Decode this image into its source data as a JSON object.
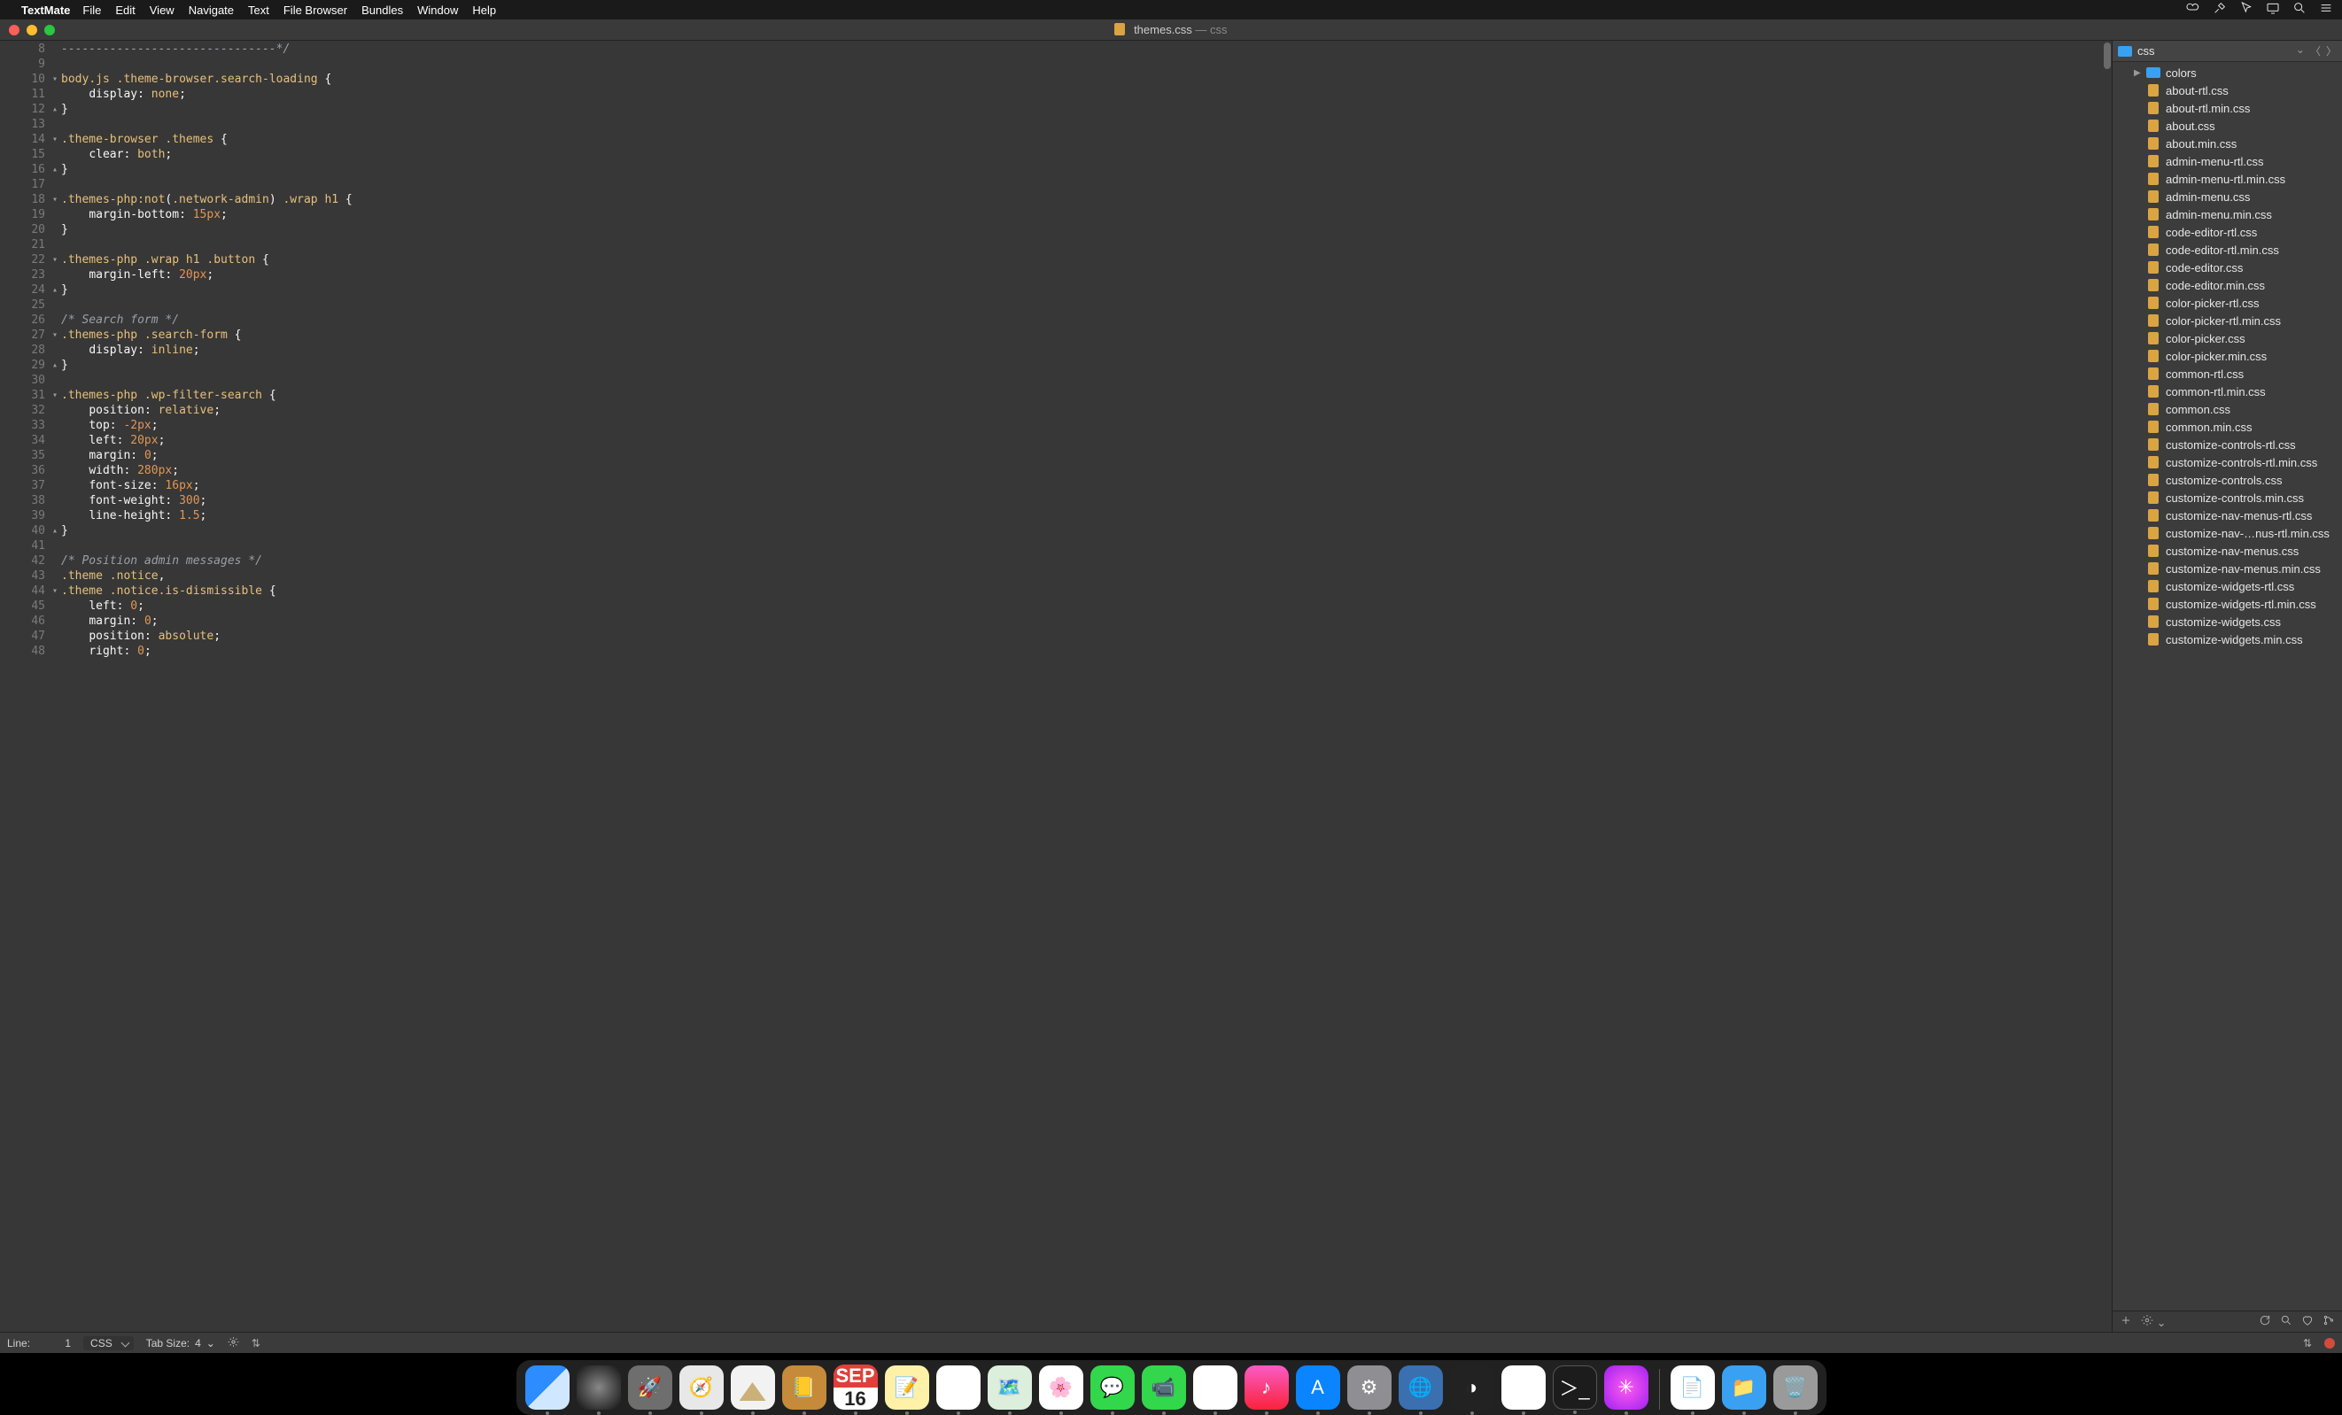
{
  "menubar": {
    "app": "TextMate",
    "items": [
      "File",
      "Edit",
      "View",
      "Navigate",
      "Text",
      "File Browser",
      "Bundles",
      "Window",
      "Help"
    ]
  },
  "window": {
    "filename": "themes.css",
    "title_suffix": " — css"
  },
  "gutter": {
    "start": 8,
    "end": 48,
    "fold_down": [
      10,
      14,
      18,
      22,
      27,
      31,
      44
    ],
    "fold_up": [
      12,
      16,
      24,
      29,
      40
    ]
  },
  "code": [
    {
      "n": 8,
      "html": "<span class='cmt'>-------------------------------*/</span>"
    },
    {
      "n": 9,
      "html": ""
    },
    {
      "n": 10,
      "html": "<span class='tag'>body</span><span class='sel'>.js</span> <span class='sel'>.theme-browser</span><span class='sel'>.search-loading</span> <span class='pun'>{</span>"
    },
    {
      "n": 11,
      "html": "    <span class='prop'>display</span><span class='pun'>:</span> <span class='ps'>none</span><span class='pun'>;</span>"
    },
    {
      "n": 12,
      "html": "<span class='pun'>}</span>"
    },
    {
      "n": 13,
      "html": ""
    },
    {
      "n": 14,
      "html": "<span class='sel'>.theme-browser</span> <span class='sel'>.themes</span> <span class='pun'>{</span>"
    },
    {
      "n": 15,
      "html": "    <span class='prop'>clear</span><span class='pun'>:</span> <span class='ps'>both</span><span class='pun'>;</span>"
    },
    {
      "n": 16,
      "html": "<span class='pun'>}</span>"
    },
    {
      "n": 17,
      "html": ""
    },
    {
      "n": 18,
      "html": "<span class='sel'>.themes-php</span><span class='ps'>:not</span><span class='pun'>(</span><span class='sel'>.network-admin</span><span class='pun'>)</span> <span class='sel'>.wrap</span> <span class='tag'>h1</span> <span class='pun'>{</span>"
    },
    {
      "n": 19,
      "html": "    <span class='prop'>margin-bottom</span><span class='pun'>:</span> <span class='num'>15px</span><span class='pun'>;</span>"
    },
    {
      "n": 20,
      "html": "<span class='pun'>}</span>"
    },
    {
      "n": 21,
      "html": ""
    },
    {
      "n": 22,
      "html": "<span class='sel'>.themes-php</span> <span class='sel'>.wrap</span> <span class='tag'>h1</span> <span class='sel'>.button</span> <span class='pun'>{</span>"
    },
    {
      "n": 23,
      "html": "    <span class='prop'>margin-left</span><span class='pun'>:</span> <span class='num'>20px</span><span class='pun'>;</span>"
    },
    {
      "n": 24,
      "html": "<span class='pun'>}</span>"
    },
    {
      "n": 25,
      "html": ""
    },
    {
      "n": 26,
      "html": "<span class='cmt'>/* Search form */</span>"
    },
    {
      "n": 27,
      "html": "<span class='sel'>.themes-php</span> <span class='sel'>.search-form</span> <span class='pun'>{</span>"
    },
    {
      "n": 28,
      "html": "    <span class='prop'>display</span><span class='pun'>:</span> <span class='ps'>inline</span><span class='pun'>;</span>"
    },
    {
      "n": 29,
      "html": "<span class='pun'>}</span>"
    },
    {
      "n": 30,
      "html": ""
    },
    {
      "n": 31,
      "html": "<span class='sel'>.themes-php</span> <span class='sel'>.wp-filter-search</span> <span class='pun'>{</span>"
    },
    {
      "n": 32,
      "html": "    <span class='prop'>position</span><span class='pun'>:</span> <span class='ps'>relative</span><span class='pun'>;</span>"
    },
    {
      "n": 33,
      "html": "    <span class='prop'>top</span><span class='pun'>:</span> <span class='num'>-2px</span><span class='pun'>;</span>"
    },
    {
      "n": 34,
      "html": "    <span class='prop'>left</span><span class='pun'>:</span> <span class='num'>20px</span><span class='pun'>;</span>"
    },
    {
      "n": 35,
      "html": "    <span class='prop'>margin</span><span class='pun'>:</span> <span class='num'>0</span><span class='pun'>;</span>"
    },
    {
      "n": 36,
      "html": "    <span class='prop'>width</span><span class='pun'>:</span> <span class='num'>280px</span><span class='pun'>;</span>"
    },
    {
      "n": 37,
      "html": "    <span class='prop'>font-size</span><span class='pun'>:</span> <span class='num'>16px</span><span class='pun'>;</span>"
    },
    {
      "n": 38,
      "html": "    <span class='prop'>font-weight</span><span class='pun'>:</span> <span class='num'>300</span><span class='pun'>;</span>"
    },
    {
      "n": 39,
      "html": "    <span class='prop'>line-height</span><span class='pun'>:</span> <span class='num'>1.5</span><span class='pun'>;</span>"
    },
    {
      "n": 40,
      "html": "<span class='pun'>}</span>"
    },
    {
      "n": 41,
      "html": ""
    },
    {
      "n": 42,
      "html": "<span class='cmt'>/* Position admin messages */</span>"
    },
    {
      "n": 43,
      "html": "<span class='sel'>.theme</span> <span class='sel'>.notice</span><span class='pun'>,</span>"
    },
    {
      "n": 44,
      "html": "<span class='sel'>.theme</span> <span class='sel'>.notice</span><span class='sel'>.is-dismissible</span> <span class='pun'>{</span>"
    },
    {
      "n": 45,
      "html": "    <span class='prop'>left</span><span class='pun'>:</span> <span class='num'>0</span><span class='pun'>;</span>"
    },
    {
      "n": 46,
      "html": "    <span class='prop'>margin</span><span class='pun'>:</span> <span class='num'>0</span><span class='pun'>;</span>"
    },
    {
      "n": 47,
      "html": "    <span class='prop'>position</span><span class='pun'>:</span> <span class='ps'>absolute</span><span class='pun'>;</span>"
    },
    {
      "n": 48,
      "html": "    <span class='prop'>right</span><span class='pun'>:</span> <span class='num'>0</span><span class='pun'>;</span>"
    }
  ],
  "sidebar": {
    "root": "css",
    "folders": [
      "colors"
    ],
    "files": [
      "about-rtl.css",
      "about-rtl.min.css",
      "about.css",
      "about.min.css",
      "admin-menu-rtl.css",
      "admin-menu-rtl.min.css",
      "admin-menu.css",
      "admin-menu.min.css",
      "code-editor-rtl.css",
      "code-editor-rtl.min.css",
      "code-editor.css",
      "code-editor.min.css",
      "color-picker-rtl.css",
      "color-picker-rtl.min.css",
      "color-picker.css",
      "color-picker.min.css",
      "common-rtl.css",
      "common-rtl.min.css",
      "common.css",
      "common.min.css",
      "customize-controls-rtl.css",
      "customize-controls-rtl.min.css",
      "customize-controls.css",
      "customize-controls.min.css",
      "customize-nav-menus-rtl.css",
      "customize-nav-…nus-rtl.min.css",
      "customize-nav-menus.css",
      "customize-nav-menus.min.css",
      "customize-widgets-rtl.css",
      "customize-widgets-rtl.min.css",
      "customize-widgets.css",
      "customize-widgets.min.css"
    ]
  },
  "status": {
    "line_label": "Line:",
    "line_value": "1",
    "language": "CSS",
    "tab_label": "Tab Size:",
    "tab_value": "4"
  },
  "dock": {
    "calendar": {
      "month": "SEP",
      "day": "16"
    }
  }
}
